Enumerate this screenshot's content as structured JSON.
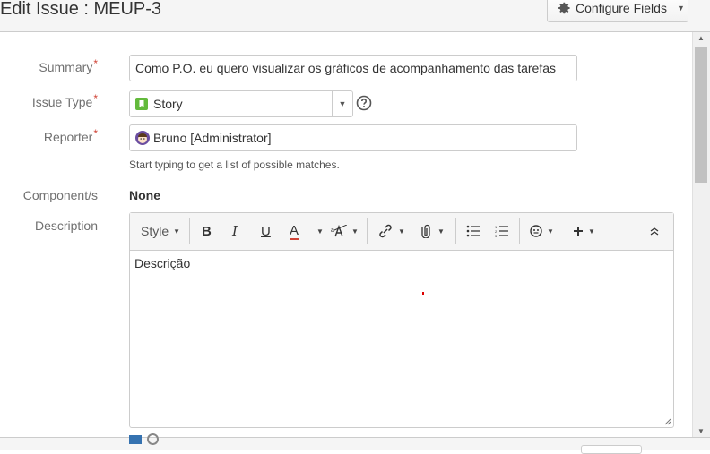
{
  "dialog": {
    "title": "Edit Issue : MEUP-3",
    "configure_fields_label": "Configure Fields"
  },
  "form": {
    "summary": {
      "label": "Summary",
      "required": "*",
      "value": "Como P.O. eu quero visualizar os gráficos de acompanhamento das tarefas"
    },
    "issue_type": {
      "label": "Issue Type",
      "required": "*",
      "value": "Story",
      "icon": "story-icon"
    },
    "reporter": {
      "label": "Reporter",
      "required": "*",
      "value": "Bruno  [Administrator]",
      "hint": "Start typing to get a list of possible matches."
    },
    "components": {
      "label": "Component/s",
      "value": "None"
    },
    "description": {
      "label": "Description",
      "value": "Descrição",
      "toolbar": {
        "style_label": "Style",
        "bold": "B",
        "italic": "I",
        "underline": "U",
        "text_color": "A"
      }
    }
  },
  "colors": {
    "required": "#d04437",
    "story": "#63ba3c",
    "text_color_underline": "#d04437"
  }
}
